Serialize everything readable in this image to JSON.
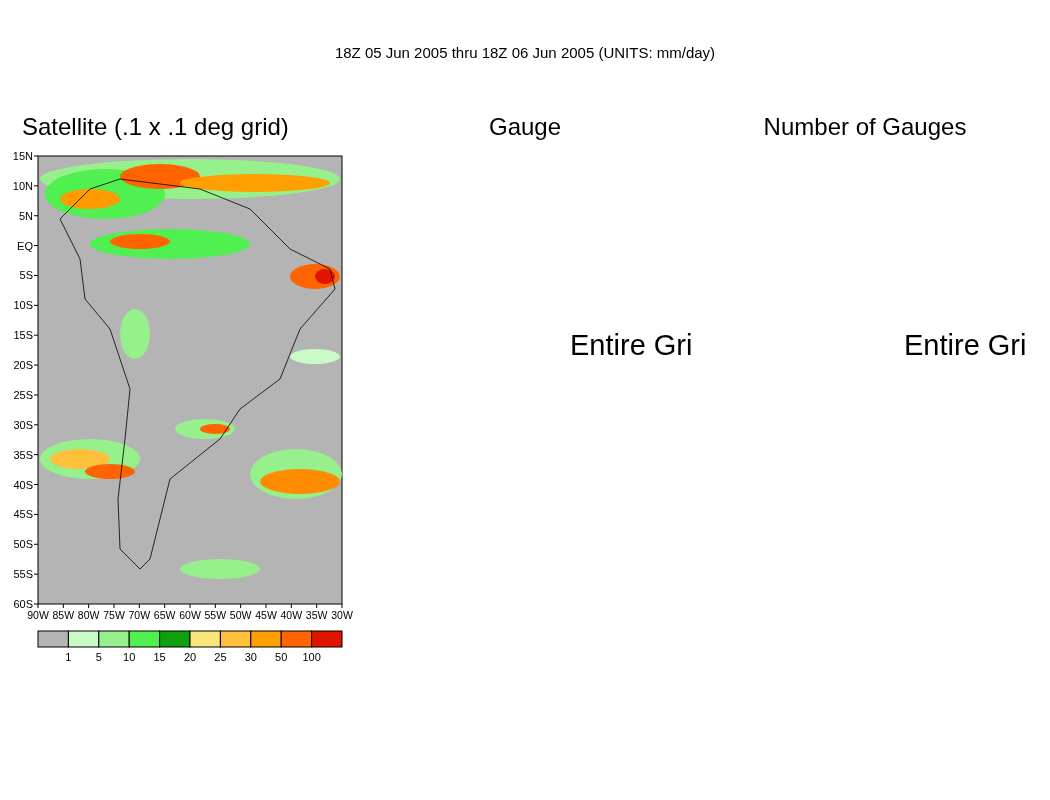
{
  "header": "18Z 05 Jun 2005 thru 18Z 06 Jun 2005 (UNITS: mm/day)",
  "panels": [
    {
      "title": "Satellite (.1 x .1 deg grid)",
      "kind": "map"
    },
    {
      "title": "Gauge",
      "kind": "message",
      "message": "Entire Gri"
    },
    {
      "title": "Number of Gauges",
      "kind": "message",
      "message": "Entire Gri"
    }
  ],
  "map": {
    "y_labels": [
      "15N",
      "10N",
      "5N",
      "EQ",
      "5S",
      "10S",
      "15S",
      "20S",
      "25S",
      "30S",
      "35S",
      "40S",
      "45S",
      "50S",
      "55S",
      "60S"
    ],
    "x_labels": [
      "90W",
      "85W",
      "80W",
      "75W",
      "70W",
      "65W",
      "60W",
      "55W",
      "50W",
      "45W",
      "40W",
      "35W",
      "30W"
    ]
  },
  "legend": {
    "bins": [
      {
        "color": "#b4b4b4"
      },
      {
        "color": "#c8fac8"
      },
      {
        "color": "#96f08c"
      },
      {
        "color": "#50f050"
      },
      {
        "color": "#0fa00f"
      },
      {
        "color": "#fae678"
      },
      {
        "color": "#ffc03c"
      },
      {
        "color": "#ffa000"
      },
      {
        "color": "#ff6400"
      },
      {
        "color": "#e11400"
      }
    ],
    "labels": [
      "1",
      "5",
      "10",
      "15",
      "20",
      "25",
      "30",
      "50",
      "100"
    ]
  }
}
